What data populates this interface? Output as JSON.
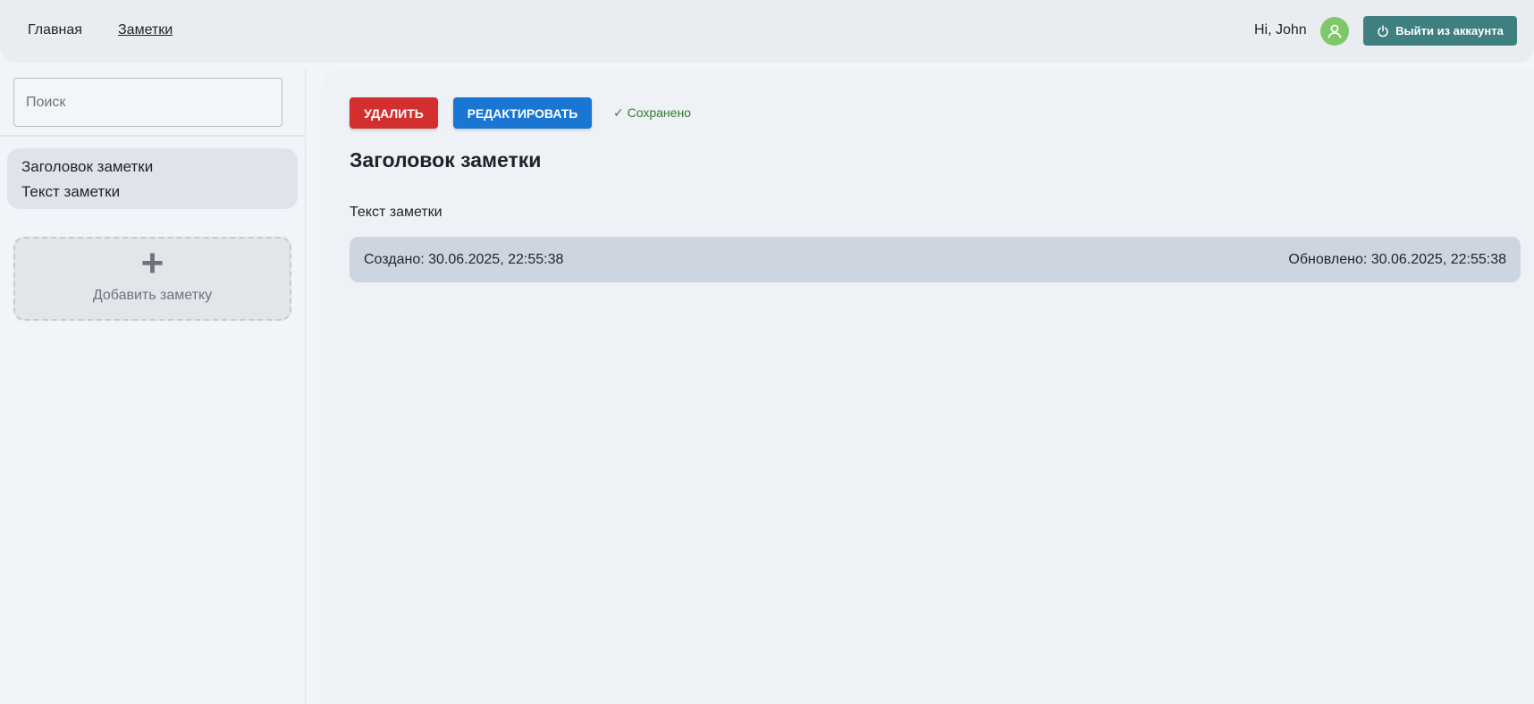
{
  "header": {
    "nav": {
      "home": "Главная",
      "notes": "Заметки"
    },
    "greeting": "Hi, John",
    "avatar_icon": "user-icon",
    "logout_label": "Выйти из аккаунта",
    "logout_icon": "power-icon"
  },
  "sidebar": {
    "search_placeholder": "Поиск",
    "notes": [
      {
        "title": "Заголовок заметки",
        "text": "Текст заметки"
      }
    ],
    "add_label": "Добавить заметку",
    "add_icon": "plus-icon"
  },
  "main": {
    "delete_label": "УДАЛИТЬ",
    "edit_label": "РЕДАКТИРОВАТЬ",
    "saved_status": "✓ Сохранено",
    "title": "Заголовок заметки",
    "text": "Текст заметки",
    "created": "Создано: 30.06.2025, 22:55:38",
    "updated": "Обновлено: 30.06.2025, 22:55:38"
  },
  "colors": {
    "delete": "#d32f2f",
    "edit": "#1976d2",
    "logout": "#3f7f80",
    "avatar": "#7fc86a",
    "saved": "#2e7d32"
  }
}
